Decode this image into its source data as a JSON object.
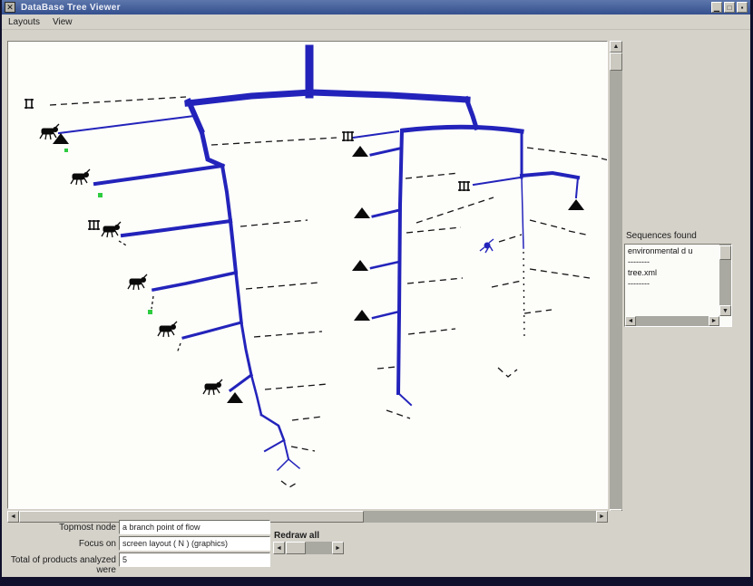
{
  "window": {
    "title": "DataBase Tree Viewer",
    "app_icon_glyph": "✕",
    "buttons": {
      "minimize": "▁",
      "maximize": "□",
      "close": "▪"
    }
  },
  "menu": {
    "items": [
      {
        "label": "Layouts"
      },
      {
        "label": "View"
      }
    ]
  },
  "canvas": {
    "background": "#fdfdfa",
    "branch_color": "#2323bb",
    "marker_color": "#0a0a0a",
    "highlight_color": "#2ecc40"
  },
  "side_panel": {
    "label": "Sequences found",
    "items": [
      "environmental d u",
      "--------",
      "tree.xml",
      "--------"
    ]
  },
  "form": {
    "topmost_label": "Topmost node",
    "topmost_value": "a branch point of flow",
    "focus_label": "Focus on",
    "focus_value": "screen layout ( N ) (graphics)",
    "total_label": "Total of products analyzed were",
    "total_value": "5",
    "slider_label": "Redraw all"
  },
  "scrollbars": {
    "up": "▲",
    "down": "▼",
    "left": "◄",
    "right": "►"
  }
}
